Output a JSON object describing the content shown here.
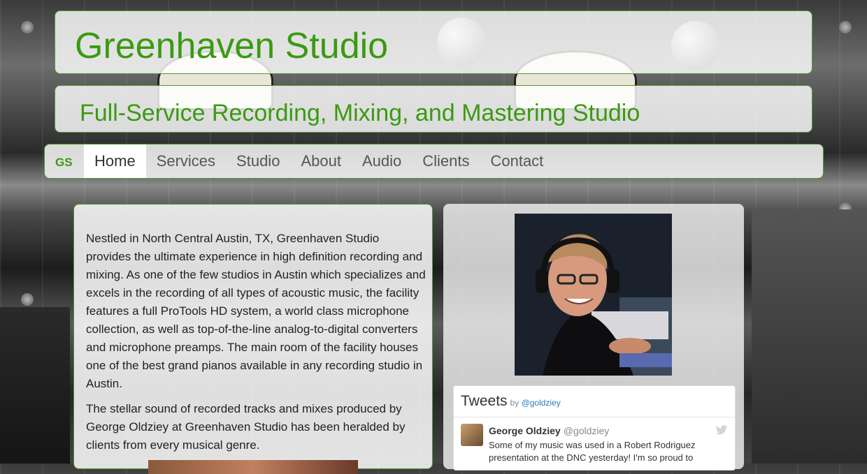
{
  "site": {
    "title": "Greenhaven Studio",
    "subtitle": "Full-Service Recording, Mixing, and Mastering Studio"
  },
  "nav": {
    "brand": "GS",
    "items": [
      {
        "label": "Home",
        "active": true
      },
      {
        "label": "Services",
        "active": false
      },
      {
        "label": "Studio",
        "active": false
      },
      {
        "label": "About",
        "active": false
      },
      {
        "label": "Audio",
        "active": false
      },
      {
        "label": "Clients",
        "active": false
      },
      {
        "label": "Contact",
        "active": false
      }
    ]
  },
  "content": {
    "paragraph1": "Nestled in North Central Austin, TX, Greenhaven Studio provides the ultimate experience in high definition recording and mixing. As one of the few studios in Austin which specializes and excels in the recording of all types of acoustic music, the facility features a full ProTools HD system, a world class microphone collection, as well as top-of-the-line analog-to-digital converters and microphone preamps. The main room of the facility houses one of the best grand pianos available in any recording studio in Austin.",
    "paragraph2": "The stellar sound of recorded tracks and mixes produced by George Oldziey at Greenhaven Studio has been heralded by clients from every musical genre."
  },
  "tweets": {
    "heading": "Tweets",
    "by_prefix": "by",
    "by_handle": "@goldziey",
    "tweet": {
      "author_name": "George Oldziey",
      "author_handle": "@goldziey",
      "text": "Some of my music was used in a Robert Rodriguez presentation at the DNC yesterday! I'm so proud to"
    }
  },
  "colors": {
    "brand_green": "#3a9a12",
    "twitter_blue": "#2b7bb9"
  },
  "icons": {
    "twitter": "twitter-bird-icon"
  }
}
